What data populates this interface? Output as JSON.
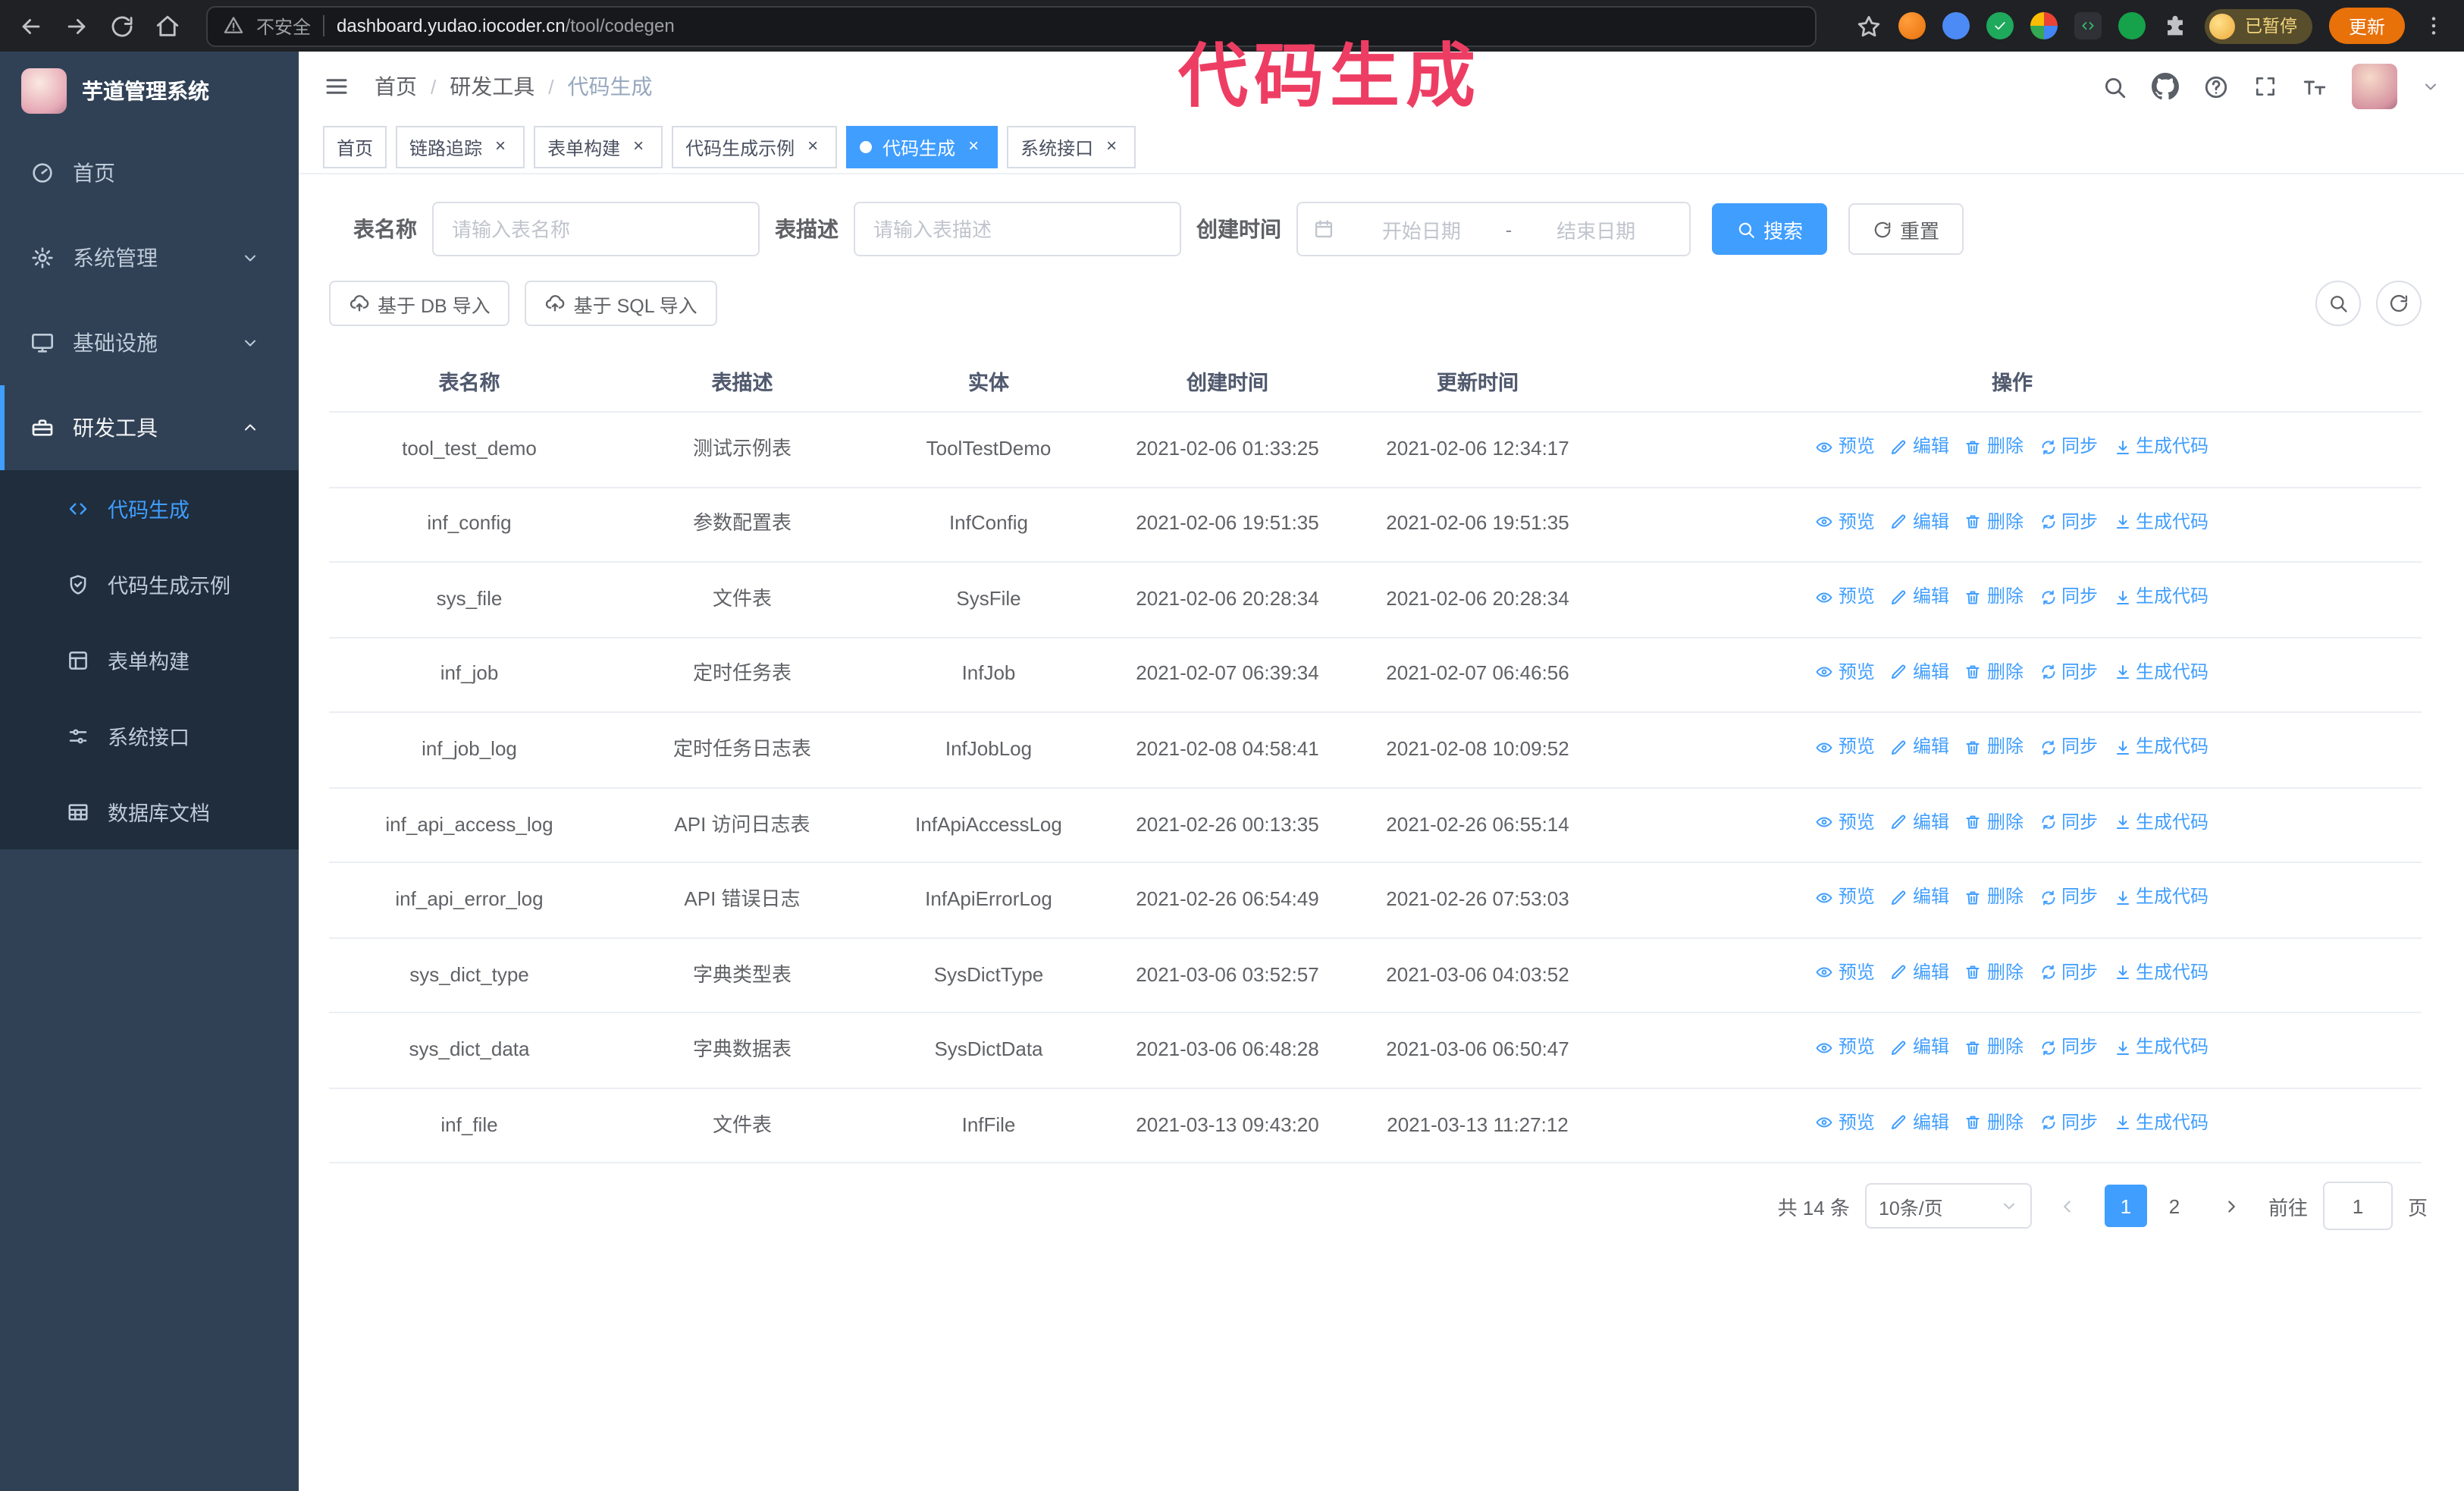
{
  "colors": {
    "primary": "#409EFF",
    "sidebar_bg": "#304156",
    "submenu_bg": "#1F2D3D"
  },
  "annotation": {
    "text": "代码生成",
    "color": "#EE3D63"
  },
  "browser": {
    "security_warning": "不安全",
    "url_host": "dashboard.yudao.iocoder.cn",
    "url_path": "/tool/codegen",
    "paused_badge": "已暂停",
    "update_button": "更新"
  },
  "sidebar": {
    "logo_title": "芋道管理系统",
    "items": [
      {
        "id": "home",
        "label": "首页",
        "icon": "dash"
      },
      {
        "id": "system",
        "label": "系统管理",
        "icon": "gear",
        "chevron": "down"
      },
      {
        "id": "infra",
        "label": "基础设施",
        "icon": "monitor",
        "chevron": "down"
      },
      {
        "id": "devtools",
        "label": "研发工具",
        "icon": "tool",
        "chevron": "up",
        "active": true,
        "children": [
          {
            "id": "codegen",
            "label": "代码生成",
            "icon": "code",
            "active": true
          },
          {
            "id": "codegen-example",
            "label": "代码生成示例",
            "icon": "shield"
          },
          {
            "id": "form-builder",
            "label": "表单构建",
            "icon": "form"
          },
          {
            "id": "api",
            "label": "系统接口",
            "icon": "sliders"
          },
          {
            "id": "db-doc",
            "label": "数据库文档",
            "icon": "table"
          }
        ]
      }
    ]
  },
  "header": {
    "breadcrumb": [
      "首页",
      "研发工具",
      "代码生成"
    ]
  },
  "tabs": [
    {
      "id": "home",
      "label": "首页",
      "closable": false
    },
    {
      "id": "tracer",
      "label": "链路追踪",
      "closable": true
    },
    {
      "id": "form-builder",
      "label": "表单构建",
      "closable": true
    },
    {
      "id": "codegen-example",
      "label": "代码生成示例",
      "closable": true
    },
    {
      "id": "codegen",
      "label": "代码生成",
      "closable": true,
      "active": true
    },
    {
      "id": "api",
      "label": "系统接口",
      "closable": true
    }
  ],
  "filters": {
    "table_name_label": "表名称",
    "table_name_placeholder": "请输入表名称",
    "table_desc_label": "表描述",
    "table_desc_placeholder": "请输入表描述",
    "create_time_label": "创建时间",
    "start_date_placeholder": "开始日期",
    "range_separator": "-",
    "end_date_placeholder": "结束日期",
    "search_button": "搜索",
    "reset_button": "重置"
  },
  "toolbar": {
    "import_db": "基于 DB 导入",
    "import_sql": "基于 SQL 导入"
  },
  "table": {
    "columns": [
      "表名称",
      "表描述",
      "实体",
      "创建时间",
      "更新时间",
      "操作"
    ],
    "actions": [
      {
        "name": "preview",
        "label": "预览",
        "icon": "eye"
      },
      {
        "name": "edit",
        "label": "编辑",
        "icon": "edit"
      },
      {
        "name": "delete",
        "label": "删除",
        "icon": "trash"
      },
      {
        "name": "sync",
        "label": "同步",
        "icon": "sync"
      },
      {
        "name": "generate-code",
        "label": "生成代码",
        "icon": "download"
      }
    ],
    "rows": [
      {
        "name": "tool_test_demo",
        "desc": "测试示例表",
        "entity": "ToolTestDemo",
        "created": "2021-02-06 01:33:25",
        "updated": "2021-02-06 12:34:17"
      },
      {
        "name": "inf_config",
        "desc": "参数配置表",
        "entity": "InfConfig",
        "created": "2021-02-06 19:51:35",
        "updated": "2021-02-06 19:51:35"
      },
      {
        "name": "sys_file",
        "desc": "文件表",
        "entity": "SysFile",
        "created": "2021-02-06 20:28:34",
        "updated": "2021-02-06 20:28:34"
      },
      {
        "name": "inf_job",
        "desc": "定时任务表",
        "entity": "InfJob",
        "created": "2021-02-07 06:39:34",
        "updated": "2021-02-07 06:46:56"
      },
      {
        "name": "inf_job_log",
        "desc": "定时任务日志表",
        "entity": "InfJobLog",
        "created": "2021-02-08 04:58:41",
        "updated": "2021-02-08 10:09:52"
      },
      {
        "name": "inf_api_access_log",
        "desc": "API 访问日志表",
        "entity": "InfApiAccessLog",
        "created": "2021-02-26 00:13:35",
        "updated": "2021-02-26 06:55:14"
      },
      {
        "name": "inf_api_error_log",
        "desc": "API 错误日志",
        "entity": "InfApiErrorLog",
        "created": "2021-02-26 06:54:49",
        "updated": "2021-02-26 07:53:03"
      },
      {
        "name": "sys_dict_type",
        "desc": "字典类型表",
        "entity": "SysDictType",
        "created": "2021-03-06 03:52:57",
        "updated": "2021-03-06 04:03:52"
      },
      {
        "name": "sys_dict_data",
        "desc": "字典数据表",
        "entity": "SysDictData",
        "created": "2021-03-06 06:48:28",
        "updated": "2021-03-06 06:50:47"
      },
      {
        "name": "inf_file",
        "desc": "文件表",
        "entity": "InfFile",
        "created": "2021-03-13 09:43:20",
        "updated": "2021-03-13 11:27:12"
      }
    ]
  },
  "pagination": {
    "total_label": "共 14 条",
    "page_size": "10条/页",
    "pages": [
      {
        "label": "1",
        "active": true
      },
      {
        "label": "2"
      }
    ],
    "goto_label": "前往",
    "goto_value": "1",
    "page_label": "页"
  }
}
